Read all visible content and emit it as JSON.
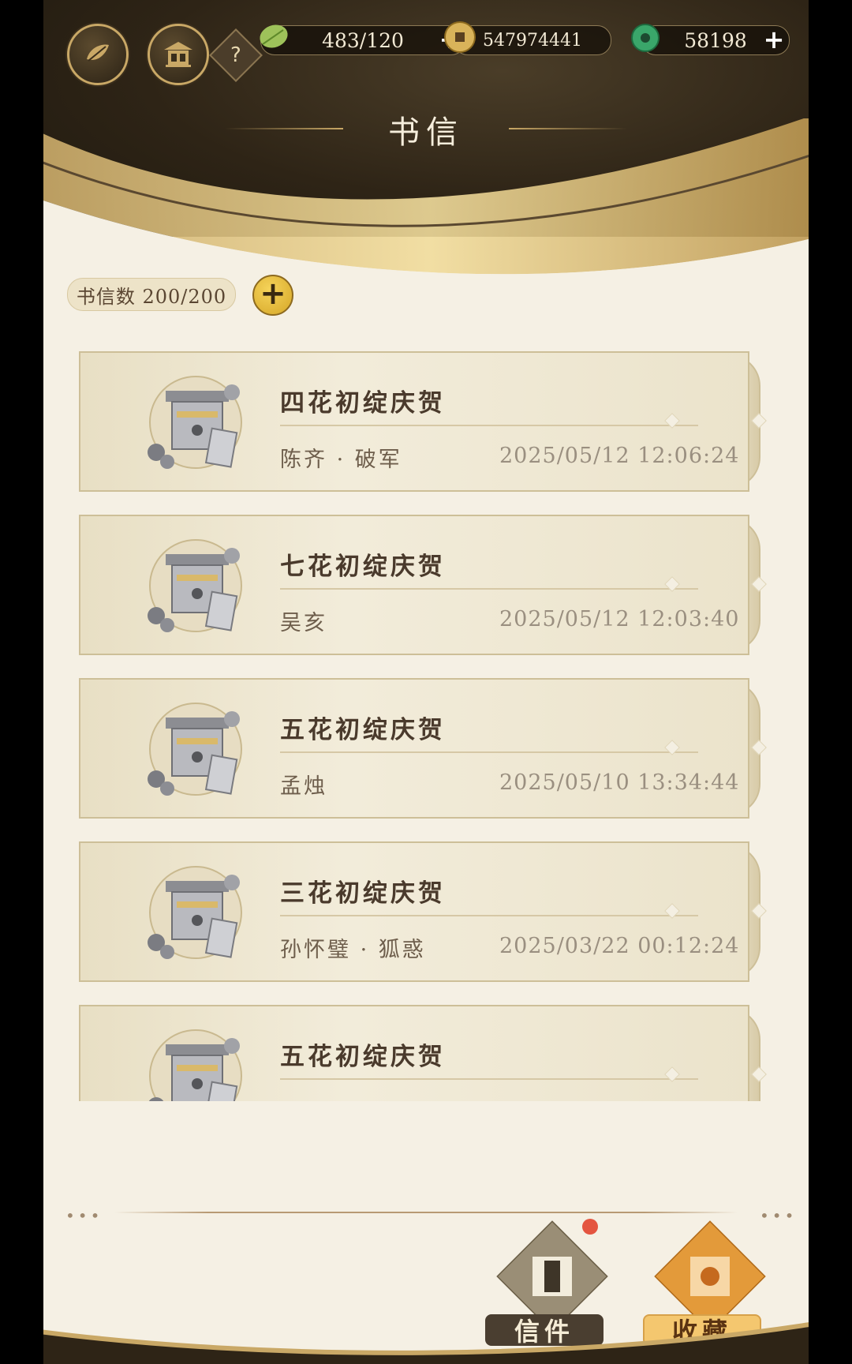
{
  "header": {
    "title": "书信",
    "resources": [
      {
        "name": "leaf",
        "icon": "leaf-icon",
        "value": "483/120",
        "has_plus": true
      },
      {
        "name": "coin",
        "icon": "coin-icon",
        "value": "547974441",
        "has_plus": false
      },
      {
        "name": "jade",
        "icon": "jade-icon",
        "value": "58198",
        "has_plus": true
      }
    ],
    "plus_symbol": "+",
    "help_symbol": "?"
  },
  "letters": {
    "count_label": "书信数 200/200",
    "add_symbol": "+",
    "items": [
      {
        "title": "四花初绽庆贺",
        "sender": "陈齐 · 破军",
        "time": "2025/05/12 12:06:24"
      },
      {
        "title": "七花初绽庆贺",
        "sender": "吴亥",
        "time": "2025/05/12 12:03:40"
      },
      {
        "title": "五花初绽庆贺",
        "sender": "孟烛",
        "time": "2025/05/10 13:34:44"
      },
      {
        "title": "三花初绽庆贺",
        "sender": "孙怀璧 · 狐惑",
        "time": "2025/03/22 00:12:24"
      },
      {
        "title": "五花初绽庆贺",
        "sender": "",
        "time": ""
      }
    ]
  },
  "tabs": [
    {
      "label": "信件",
      "active": true,
      "has_notification": true
    },
    {
      "label": "收藏",
      "active": false,
      "has_notification": false
    }
  ],
  "colors": {
    "accent_gold": "#c9a866",
    "header_dark": "#2e2416",
    "paper": "#f5f0e4",
    "notify_red": "#e45540"
  }
}
